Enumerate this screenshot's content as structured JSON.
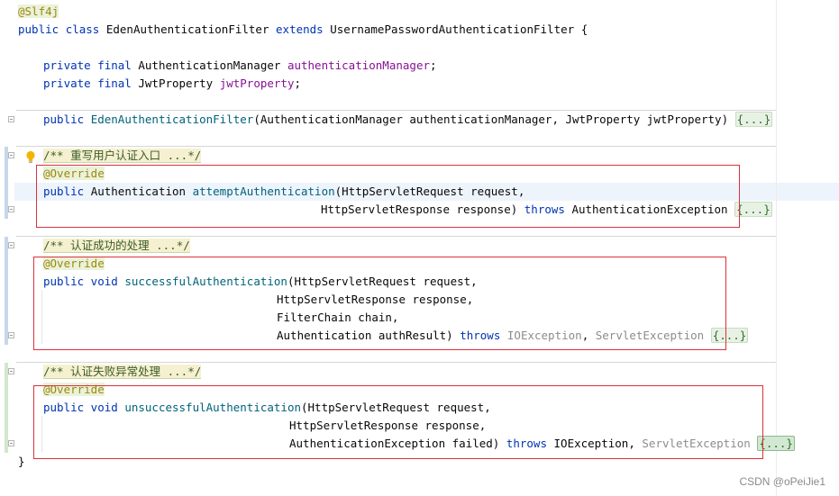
{
  "code": {
    "annotation_slf4j": "@Slf4j",
    "class_decl": {
      "kw_public": "public",
      "kw_class": "class",
      "name": "EdenAuthenticationFilter",
      "kw_extends": "extends",
      "parent": "UsernamePasswordAuthenticationFilter",
      "brace": "{"
    },
    "field1": {
      "mods": "private final",
      "type": "AuthenticationManager",
      "name": "authenticationManager",
      "end": ";"
    },
    "field2": {
      "mods": "private final",
      "type": "JwtProperty",
      "name": "jwtProperty",
      "end": ";"
    },
    "ctor": {
      "kw": "public",
      "name": "EdenAuthenticationFilter",
      "params": "(AuthenticationManager authenticationManager, JwtProperty jwtProperty)",
      "fold": "{...}"
    },
    "m1": {
      "doc": "/** 重写用户认证入口 ...*/",
      "override": "@Override",
      "sig_kw": "public",
      "ret": "Authentication",
      "name": "attemptAuthentication",
      "p1": "(HttpServletRequest request,",
      "p2": "HttpServletResponse response)",
      "throws_kw": "throws",
      "ex": "AuthenticationException",
      "fold": "{...}"
    },
    "m2": {
      "doc": "/** 认证成功的处理 ...*/",
      "override": "@Override",
      "sig_kw": "public void",
      "name": "successfulAuthentication",
      "p1": "(HttpServletRequest request,",
      "p2": "HttpServletResponse response,",
      "p3": "FilterChain chain,",
      "p4": "Authentication authResult)",
      "throws_kw": "throws",
      "ex1": "IOException",
      "comma": ",",
      "ex2": "ServletException",
      "fold": "{...}"
    },
    "m3": {
      "doc": "/** 认证失败异常处理 ...*/",
      "override": "@Override",
      "sig_kw": "public void",
      "name": "unsuccessfulAuthentication",
      "p1": "(HttpServletRequest request,",
      "p2": "HttpServletResponse response,",
      "p3": "AuthenticationException failed)",
      "throws_kw": "throws",
      "ex1": "IOException",
      "comma": ",",
      "ex2": "ServletException",
      "fold": "{...}"
    },
    "closing_brace": "}"
  },
  "watermark": "CSDN @oPeiJie1",
  "icons": {
    "bulb": "lightbulb-icon",
    "fold": "fold-marker-icon"
  }
}
